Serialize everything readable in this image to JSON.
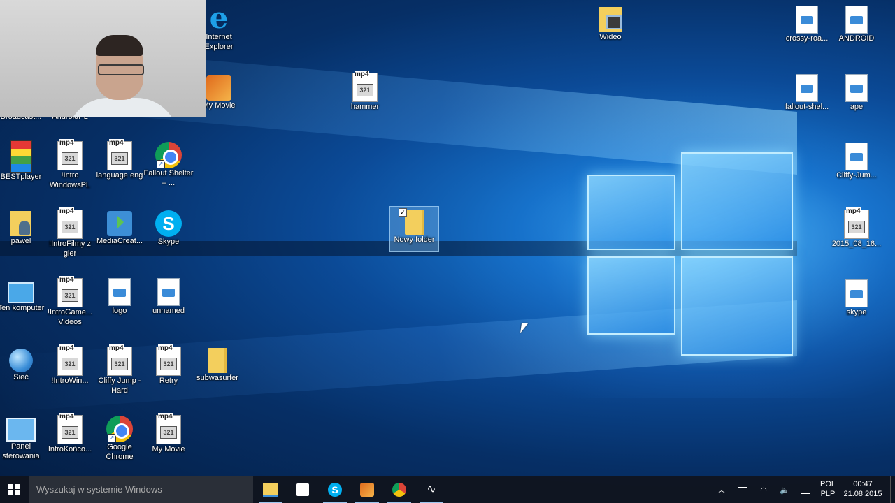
{
  "webcam": {
    "label": "Webcam overlay"
  },
  "desktop_icons": [
    {
      "id": "broadcast",
      "label": "Broadcast...",
      "icon": "app-icon"
    },
    {
      "id": "androidpl",
      "label": "AndroidPL",
      "icon": "folder-icon"
    },
    {
      "id": "ie",
      "label": "Internet Explorer",
      "icon": "internet-explorer-icon"
    },
    {
      "id": "mymovie-top",
      "label": "My Movie",
      "icon": "movie-maker-icon"
    },
    {
      "id": "hammer",
      "label": "hammer",
      "icon": "mp4-icon"
    },
    {
      "id": "wideo",
      "label": "Wideo",
      "icon": "video-folder-icon"
    },
    {
      "id": "crossy",
      "label": "crossy-roa...",
      "icon": "image-file-icon"
    },
    {
      "id": "android",
      "label": "ANDROID",
      "icon": "image-file-icon"
    },
    {
      "id": "fallout-shel",
      "label": "fallout-shel...",
      "icon": "image-file-icon"
    },
    {
      "id": "ape",
      "label": "ape",
      "icon": "image-file-icon"
    },
    {
      "id": "cliffy-jum",
      "label": "Cliffy-Jum...",
      "icon": "image-file-icon"
    },
    {
      "id": "2015_08_16",
      "label": "2015_08_16...",
      "icon": "mp4-icon"
    },
    {
      "id": "skype-img",
      "label": "skype",
      "icon": "image-file-icon"
    },
    {
      "id": "bestplayer",
      "label": "BESTplayer",
      "icon": "bestplayer-icon"
    },
    {
      "id": "intro-windows",
      "label": "!Intro WindowsPL",
      "icon": "mp4-icon"
    },
    {
      "id": "language",
      "label": "language eng",
      "icon": "mp4-icon"
    },
    {
      "id": "fallout",
      "label": "Fallout Shelter – ...",
      "icon": "chrome-icon"
    },
    {
      "id": "pawel",
      "label": "pawel",
      "icon": "user-folder-icon"
    },
    {
      "id": "intro-filmy",
      "label": "!IntroFilmy z gier",
      "icon": "mp4-icon"
    },
    {
      "id": "mediacreat",
      "label": "MediaCreat...",
      "icon": "media-creation-icon"
    },
    {
      "id": "skype",
      "label": "Skype",
      "icon": "skype-icon"
    },
    {
      "id": "nowy-folder",
      "label": "Nowy folder",
      "icon": "folder-icon"
    },
    {
      "id": "ten-komputer",
      "label": "Ten komputer",
      "icon": "computer-icon"
    },
    {
      "id": "intro-game",
      "label": "!IntroGame... Videos",
      "icon": "mp4-icon"
    },
    {
      "id": "logo",
      "label": "logo",
      "icon": "image-file-icon"
    },
    {
      "id": "unnamed",
      "label": "unnamed",
      "icon": "image-file-icon"
    },
    {
      "id": "siec",
      "label": "Sieć",
      "icon": "network-icon"
    },
    {
      "id": "intro-win",
      "label": "!IntroWin...",
      "icon": "mp4-icon"
    },
    {
      "id": "cliffy-hard",
      "label": "Cliffy Jump - Hard",
      "icon": "mp4-icon"
    },
    {
      "id": "retry",
      "label": "Retry",
      "icon": "mp4-icon"
    },
    {
      "id": "subwasurfer",
      "label": "subwasurfer",
      "icon": "folder-icon"
    },
    {
      "id": "panel",
      "label": "Panel sterowania",
      "icon": "control-panel-icon"
    },
    {
      "id": "intro-konco",
      "label": "IntroKońco...",
      "icon": "mp4-icon"
    },
    {
      "id": "google-chrome",
      "label": "Google Chrome",
      "icon": "chrome-icon"
    },
    {
      "id": "my-movie",
      "label": "My Movie",
      "icon": "mp4-icon"
    }
  ],
  "mp4_badge": "mp4",
  "mp4_number": "321",
  "taskbar": {
    "search_placeholder": "Wyszukaj w systemie Windows",
    "pinned": [
      "file-explorer-icon",
      "store-icon",
      "skype-icon",
      "movie-maker-icon",
      "chrome-icon",
      "media-player-icon"
    ],
    "tray": {
      "language_top": "POL",
      "language_bottom": "PLP",
      "time": "00:47",
      "date": "21.08.2015"
    }
  }
}
